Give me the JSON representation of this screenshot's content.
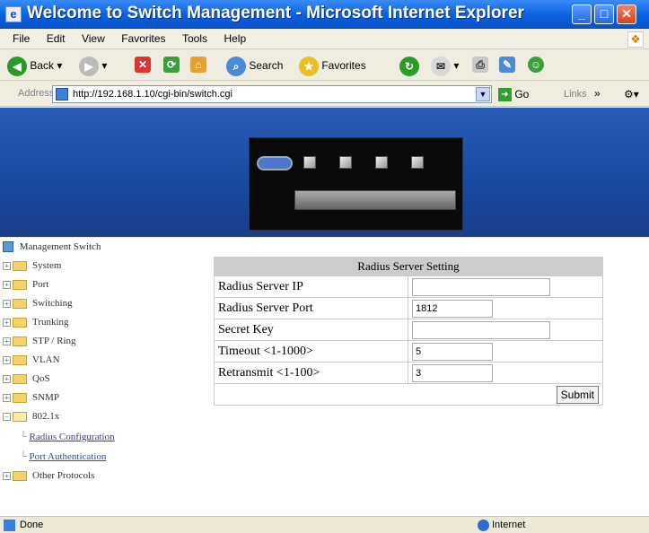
{
  "window": {
    "title": "Welcome to Switch Management - Microsoft Internet Explorer"
  },
  "menu": [
    "File",
    "Edit",
    "View",
    "Favorites",
    "Tools",
    "Help"
  ],
  "toolbar": {
    "back": "Back",
    "search": "Search",
    "favorites": "Favorites"
  },
  "address": {
    "label": "Address",
    "url": "http://192.168.1.10/cgi-bin/switch.cgi",
    "go": "Go",
    "links": "Links"
  },
  "sidebar": {
    "root": "Management Switch",
    "items": [
      "System",
      "Port",
      "Switching",
      "Trunking",
      "STP / Ring",
      "VLAN",
      "QoS",
      "SNMP",
      "802.1x"
    ],
    "sub_items": [
      "Radius Configuration",
      "Port Authentication"
    ],
    "last_item": "Other Protocols"
  },
  "form": {
    "title": "Radius Server Setting",
    "rows": [
      {
        "label": "Radius Server IP",
        "value": ""
      },
      {
        "label": "Radius Server Port",
        "value": "1812"
      },
      {
        "label": "Secret Key",
        "value": ""
      },
      {
        "label": "Timeout <1-1000>",
        "value": "5"
      },
      {
        "label": "Retransmit <1-100>",
        "value": "3"
      }
    ],
    "submit": "Submit"
  },
  "status": {
    "text": "Done",
    "zone": "Internet"
  }
}
